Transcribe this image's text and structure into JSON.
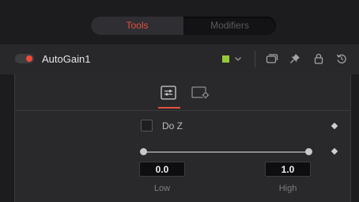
{
  "tabs": {
    "tools_label": "Tools",
    "modifiers_label": "Modifiers",
    "active": "Tools"
  },
  "tool": {
    "name": "AutoGain1",
    "enabled": true,
    "color_chip": "#96c93a"
  },
  "controls": {
    "do_z": {
      "label": "Do Z",
      "checked": false
    },
    "range": {
      "low": {
        "value": "0.0",
        "label": "Low"
      },
      "high": {
        "value": "1.0",
        "label": "High"
      }
    }
  },
  "colors": {
    "accent": "#e2503e",
    "power_on": "#ef4b36"
  },
  "icons": [
    "power-toggle-icon",
    "chevron-down-icon",
    "version-icon",
    "pin-icon",
    "lock-icon",
    "reset-icon",
    "controls-tab-icon",
    "settings-tab-icon",
    "keyframe-icon"
  ]
}
